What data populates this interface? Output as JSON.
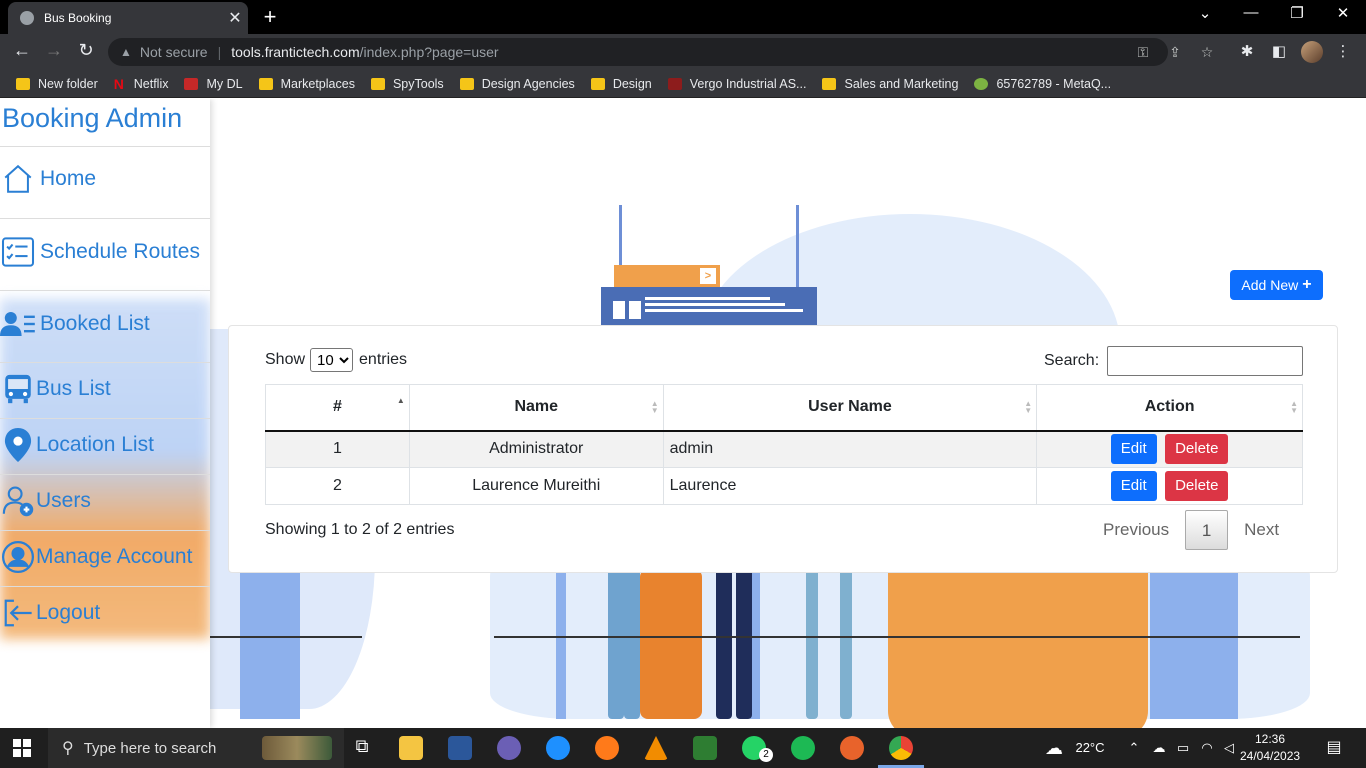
{
  "browser": {
    "tab_title": "Bus Booking",
    "tab_close": "✕",
    "new_tab": "+",
    "security": "Not secure",
    "url_host": "tools.frantictech.com",
    "url_path": "/index.php?page=user",
    "bookmarks": [
      {
        "label": "New folder",
        "icon": "folder-icon"
      },
      {
        "label": "Netflix",
        "icon": "netflix-icon"
      },
      {
        "label": "My DL",
        "icon": "app-icon"
      },
      {
        "label": "Marketplaces",
        "icon": "folder-icon"
      },
      {
        "label": "SpyTools",
        "icon": "folder-icon"
      },
      {
        "label": "Design Agencies",
        "icon": "folder-icon"
      },
      {
        "label": "Design",
        "icon": "folder-icon"
      },
      {
        "label": "Vergo Industrial AS...",
        "icon": "site-icon"
      },
      {
        "label": "Sales and Marketing",
        "icon": "folder-icon"
      },
      {
        "label": "65762789 - MetaQ...",
        "icon": "metaquotes-icon"
      }
    ]
  },
  "sidebar": {
    "brand": "Booking Admin",
    "items": [
      {
        "label": "Home",
        "icon": "home-icon"
      },
      {
        "label": "Schedule Routes",
        "icon": "checklist-icon"
      },
      {
        "label": "Booked List",
        "icon": "users-list-icon"
      },
      {
        "label": "Bus List",
        "icon": "bus-icon"
      },
      {
        "label": "Location List",
        "icon": "location-pin-icon"
      },
      {
        "label": "Users",
        "icon": "user-add-icon"
      },
      {
        "label": "Manage Account",
        "icon": "account-circle-icon"
      },
      {
        "label": "Logout",
        "icon": "logout-icon"
      }
    ]
  },
  "main": {
    "add_new_label": "Add New",
    "show_label": "Show",
    "entries_label": "entries",
    "page_length": "10",
    "search_label": "Search:",
    "search_value": "",
    "columns": [
      "#",
      "Name",
      "User Name",
      "Action"
    ],
    "rows": [
      {
        "num": "1",
        "name": "Administrator",
        "username": "admin"
      },
      {
        "num": "2",
        "name": "Laurence Mureithi",
        "username": "Laurence"
      }
    ],
    "edit_label": "Edit",
    "delete_label": "Delete",
    "info": "Showing 1 to 2 of 2 entries",
    "previous": "Previous",
    "current_page": "1",
    "next": "Next"
  },
  "taskbar": {
    "search_placeholder": "Type here to search",
    "weather": "22°C",
    "time": "12:36",
    "date": "24/04/2023",
    "whatsapp_badge": "2"
  },
  "colors": {
    "accent": "#2a7fd4",
    "primary_button": "#0d6efd",
    "danger_button": "#dc3545"
  }
}
